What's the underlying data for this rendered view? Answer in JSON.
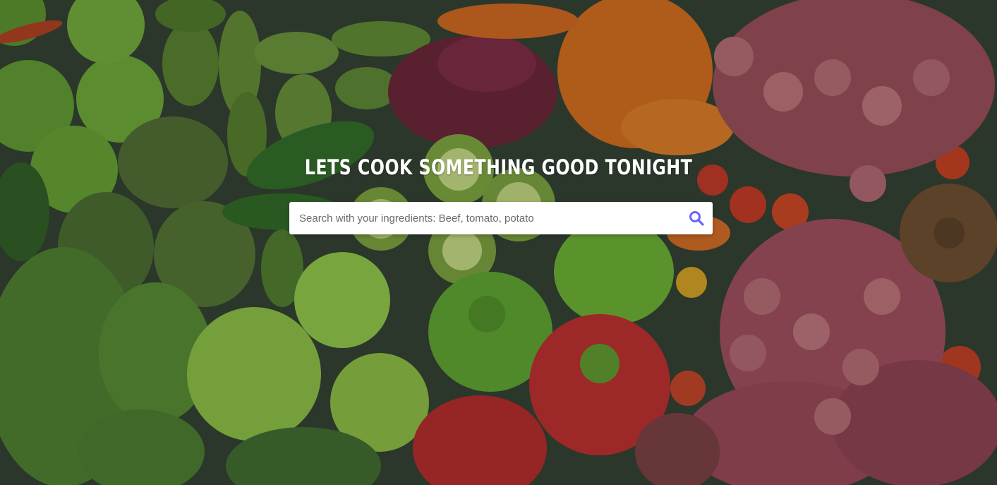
{
  "hero": {
    "headline": "LETS COOK SOMETHING GOOD TONIGHT",
    "background_icon": "vegetables-photo"
  },
  "search": {
    "placeholder": "Search with your ingredients: Beef, tomato, potato",
    "value": "",
    "icon": "search-icon",
    "icon_color": "#6c63ff"
  }
}
